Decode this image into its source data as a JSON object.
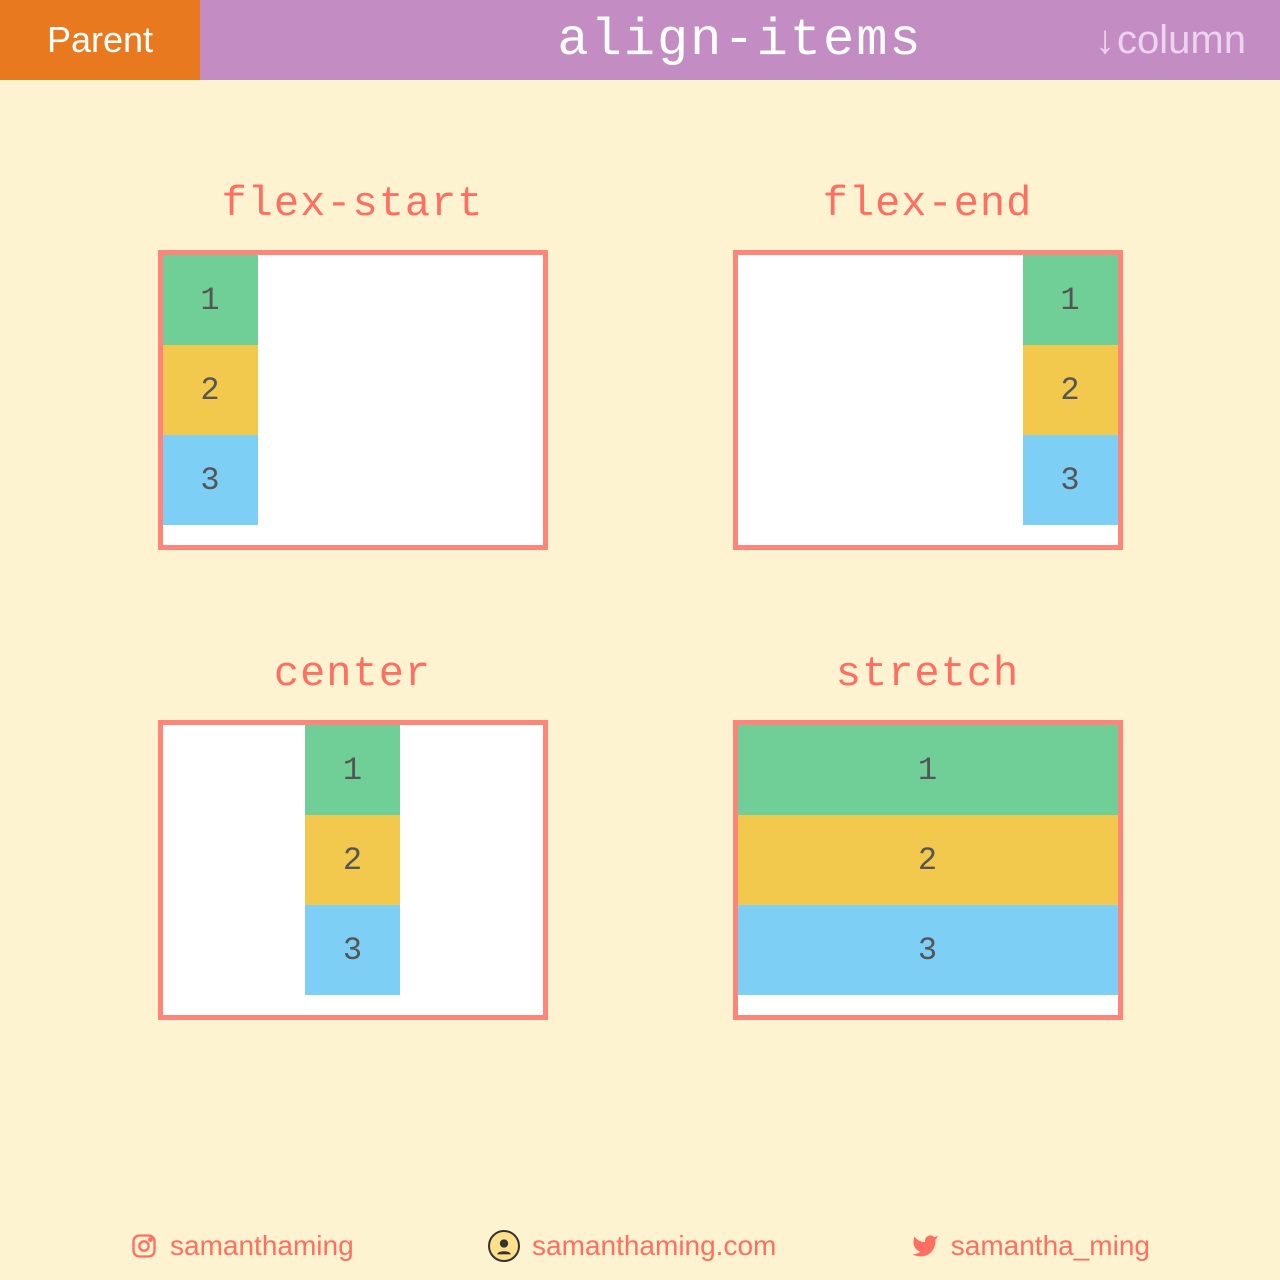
{
  "header": {
    "parent_tag": "Parent",
    "title": "align-items",
    "direction_arrow": "↓",
    "direction_label": "column"
  },
  "examples": [
    {
      "label": "flex-start",
      "align": "fs",
      "items": [
        "1",
        "2",
        "3"
      ]
    },
    {
      "label": "flex-end",
      "align": "fe",
      "items": [
        "1",
        "2",
        "3"
      ]
    },
    {
      "label": "center",
      "align": "ce",
      "items": [
        "1",
        "2",
        "3"
      ]
    },
    {
      "label": "stretch",
      "align": "st",
      "items": [
        "1",
        "2",
        "3"
      ]
    }
  ],
  "footer": {
    "instagram": "samanthaming",
    "website": "samanthaming.com",
    "twitter": "samantha_ming"
  }
}
